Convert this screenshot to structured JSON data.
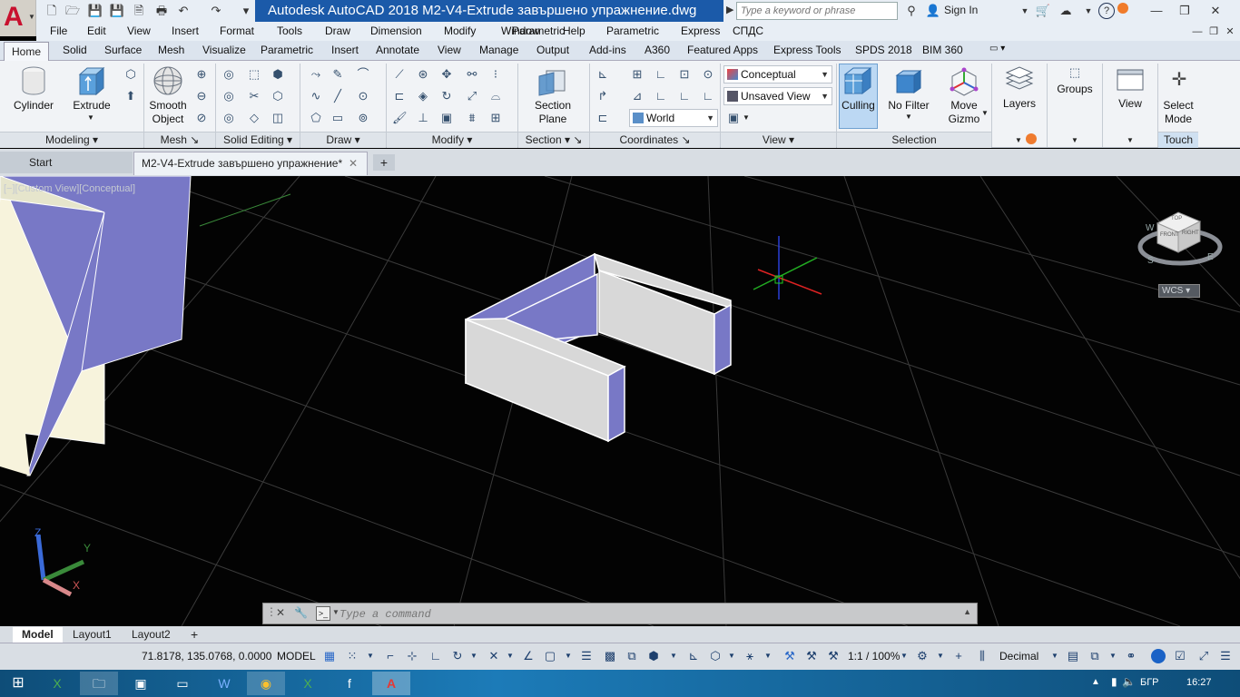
{
  "title_bar": {
    "title": "Autodesk AutoCAD 2018    M2-V4-Extrude завършено упражнение.dwg",
    "search_placeholder": "Type a keyword or phrase",
    "sign_in": "Sign In"
  },
  "menu": [
    "File",
    "Edit",
    "View",
    "Insert",
    "Format",
    "Tools",
    "Draw",
    "Dimension",
    "Modify",
    "Parametric",
    "Window",
    "Help",
    "Parametric",
    "Express",
    "СПДС"
  ],
  "ribbon_tabs": [
    "Solid",
    "Surface",
    "Mesh",
    "Visualize",
    "Parametric",
    "Insert",
    "Annotate",
    "View",
    "Manage",
    "Output",
    "Add-ins",
    "A360",
    "Featured Apps",
    "Express Tools",
    "SPDS 2018",
    "BIM 360"
  ],
  "active_tab": "Home",
  "buttons": {
    "cylinder": "Cylinder",
    "extrude": "Extrude",
    "smooth_object_1": "Smooth",
    "smooth_object_2": "Object",
    "section_plane_1": "Section",
    "section_plane_2": "Plane",
    "culling": "Culling",
    "no_filter": "No Filter",
    "move_gizmo_1": "Move",
    "move_gizmo_2": "Gizmo",
    "layers": "Layers",
    "groups": "Groups",
    "view": "View",
    "select_mode_1": "Select",
    "select_mode_2": "Mode"
  },
  "combos": {
    "visual_style": "Conceptual",
    "saved_view": "Unsaved View",
    "ucs": "World"
  },
  "panels": {
    "modeling": "Modeling",
    "mesh": "Mesh",
    "solid_editing": "Solid Editing",
    "draw": "Draw",
    "modify": "Modify",
    "section": "Section",
    "coordinates": "Coordinates",
    "view": "View",
    "selection": "Selection",
    "touch": "Touch"
  },
  "file_tabs": {
    "start": "Start",
    "drawing": "M2-V4-Extrude завършено упражнение*"
  },
  "viewport": {
    "label": "[−][Custom View][Conceptual]",
    "wcs": "WCS",
    "cube_top": "TOP",
    "cube_front": "FRONT",
    "cube_right": "RIGHT",
    "compass_w": "W",
    "compass_s": "S",
    "compass_e": "E",
    "axis_x": "X",
    "axis_y": "Y",
    "axis_z": "Z"
  },
  "command": {
    "placeholder": "Type a command"
  },
  "layout_tabs": [
    "Model",
    "Layout1",
    "Layout2"
  ],
  "status": {
    "coords": "71.8178, 135.0768, 0.0000",
    "model": "MODEL",
    "scale": "1:1 / 100%",
    "units": "Decimal"
  },
  "taskbar": {
    "lang": "БГР",
    "time": "16:27"
  },
  "colors": {
    "title_blue": "#1b5aa9",
    "face_purple": "#7878c6",
    "face_light": "#d8d8d8",
    "face_cream": "#f7f3dc",
    "grid": "#3a3a3a"
  }
}
